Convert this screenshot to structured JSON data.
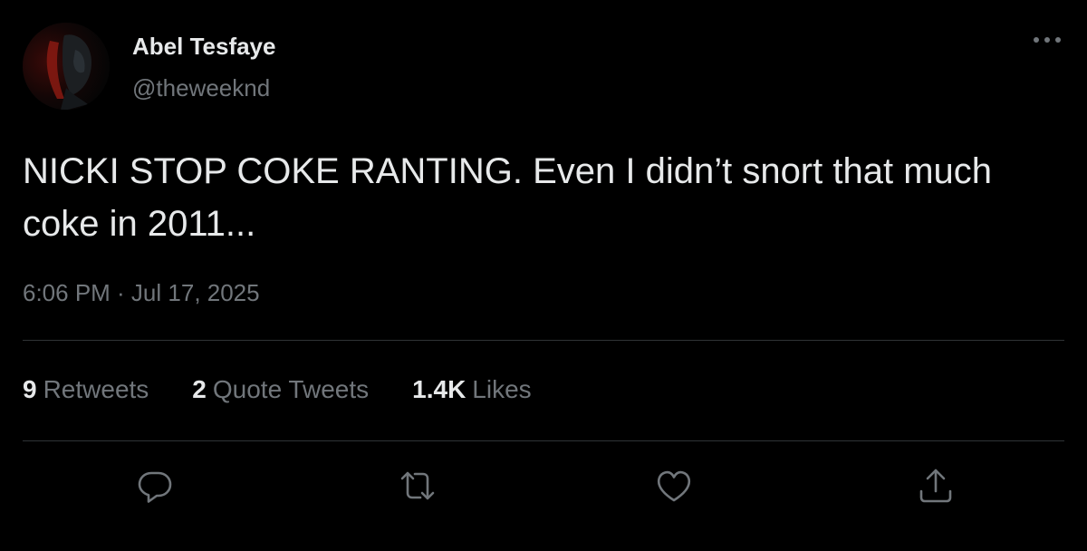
{
  "user": {
    "display_name": "Abel Tesfaye",
    "handle": "@theweeknd"
  },
  "tweet": {
    "text": "NICKI STOP COKE RANTING. Even I didn’t snort that much coke in 2011...",
    "timestamp": "6:06 PM · Jul 17, 2025"
  },
  "stats": {
    "retweets": {
      "count": "9",
      "label": "Retweets"
    },
    "quote_tweets": {
      "count": "2",
      "label": "Quote Tweets"
    },
    "likes": {
      "count": "1.4K",
      "label": "Likes"
    }
  },
  "actions": [
    "reply-icon",
    "retweet-icon",
    "like-icon",
    "share-icon"
  ],
  "colors": {
    "background": "#000000",
    "text": "#e7e9ea",
    "secondary": "#71767b",
    "divider": "#2f3336"
  }
}
